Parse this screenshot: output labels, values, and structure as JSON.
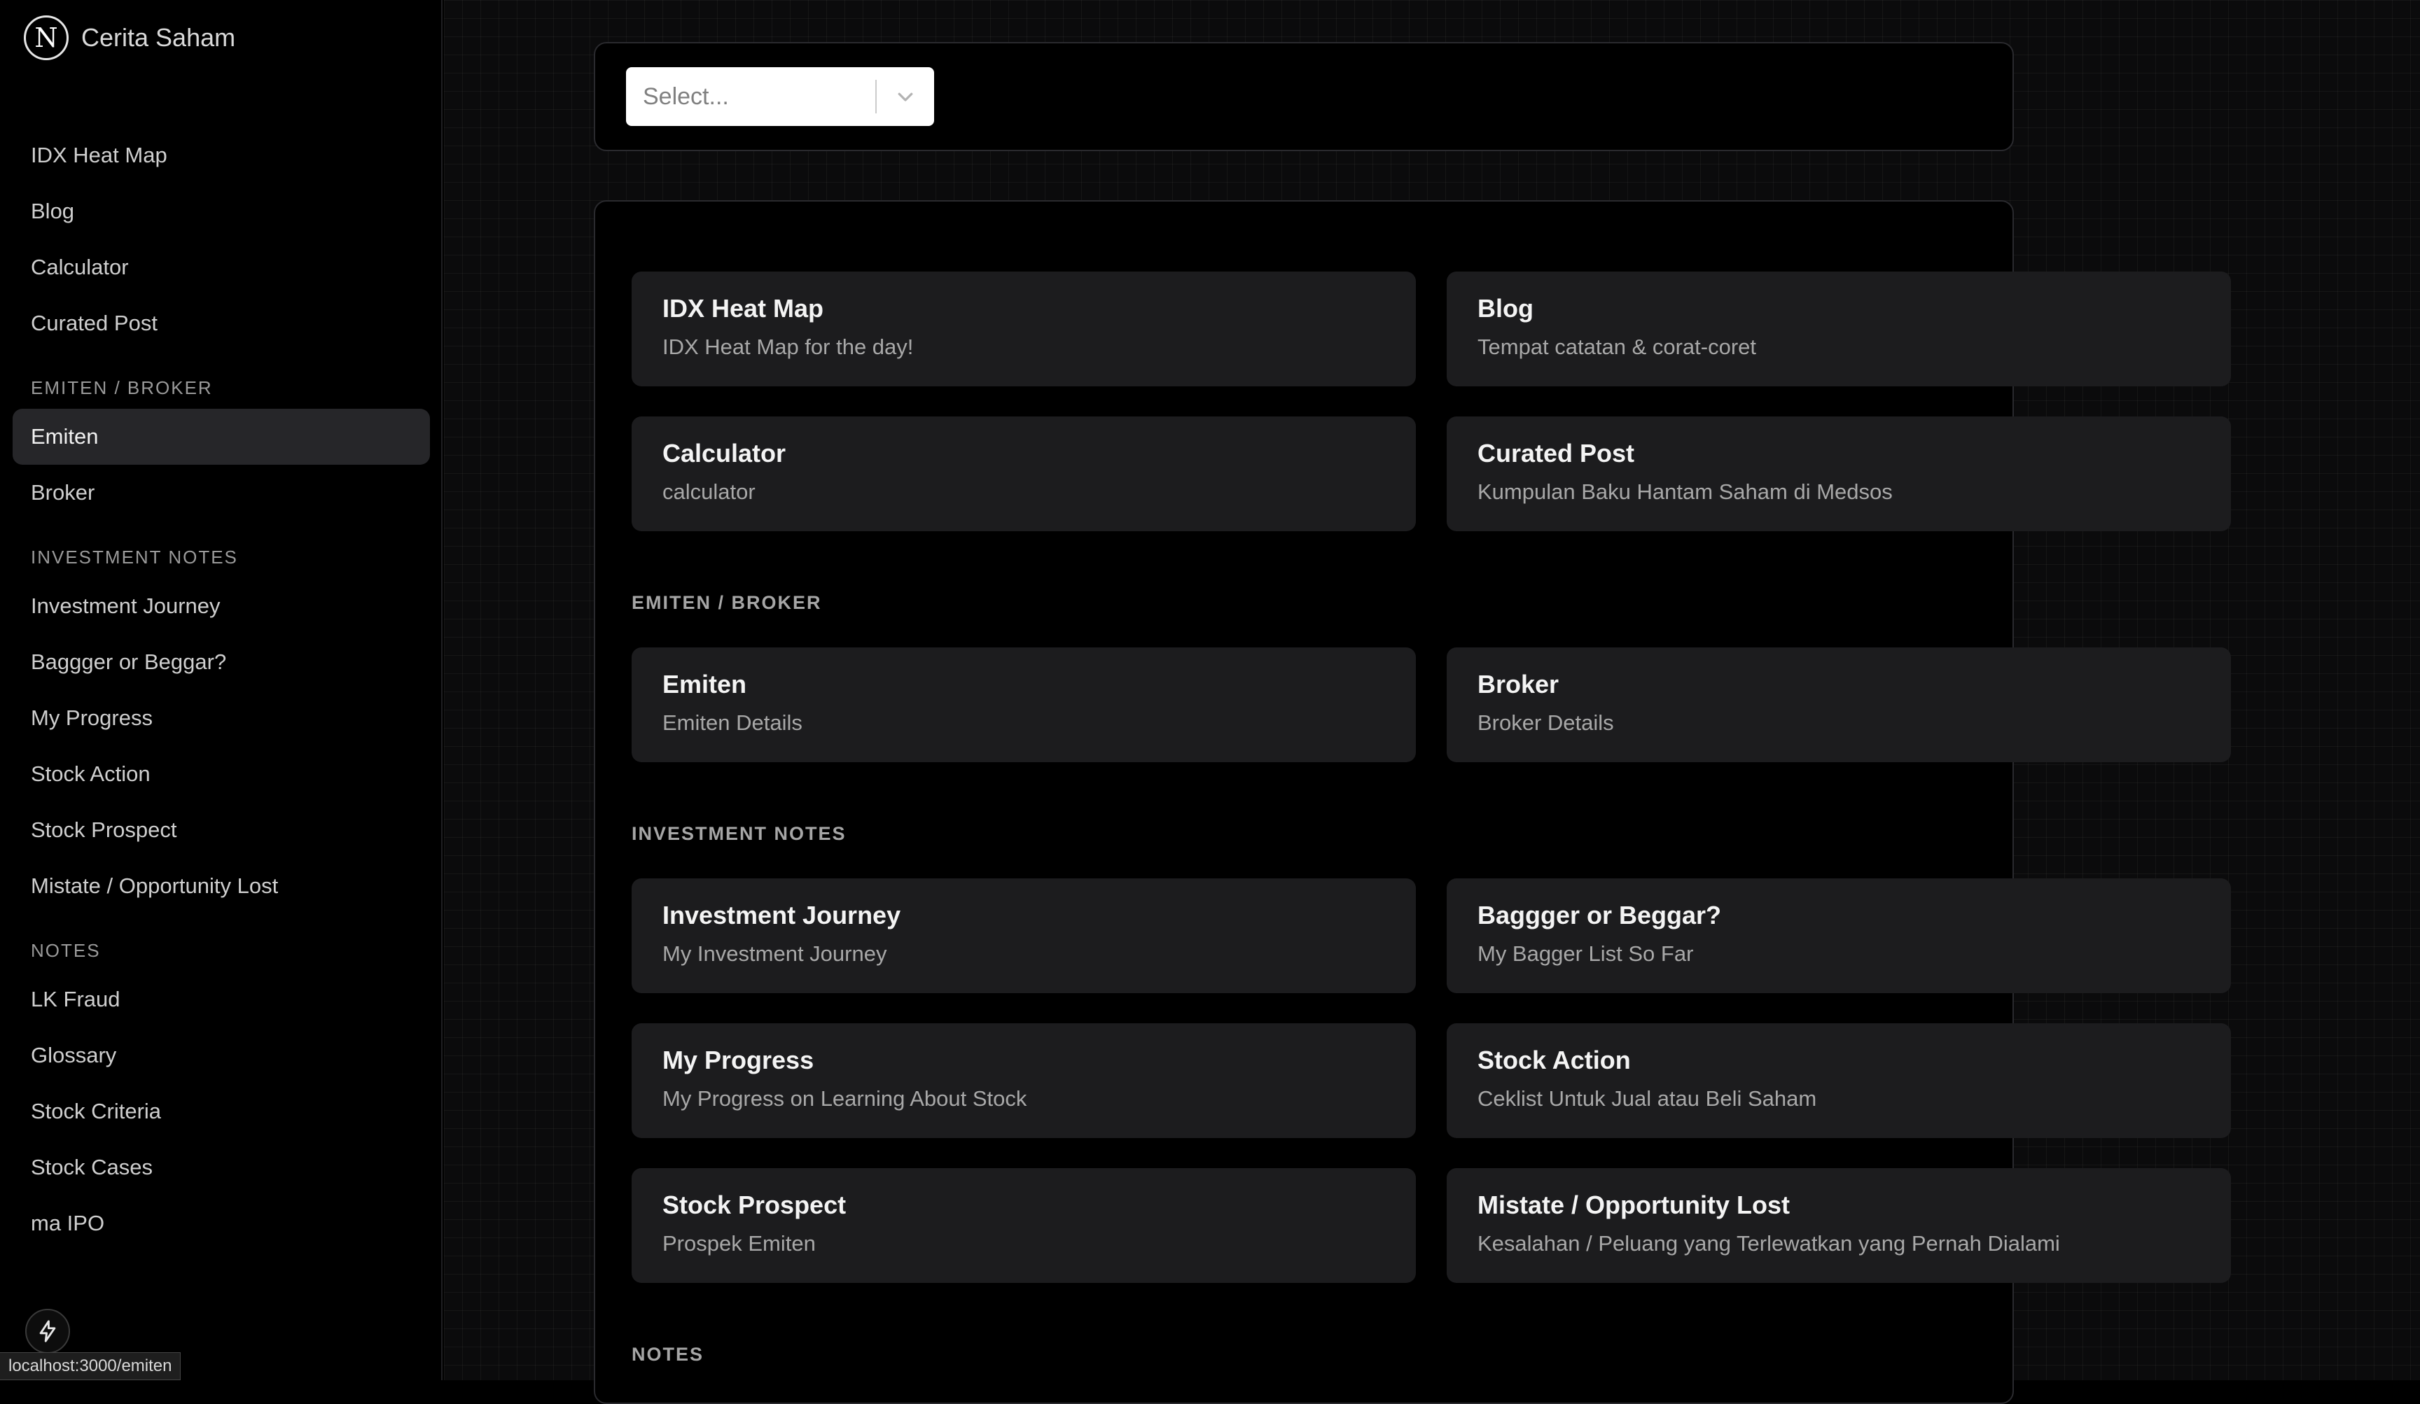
{
  "brand": {
    "logo_letter": "N",
    "name": "Cerita Saham"
  },
  "sidebar": {
    "items": [
      {
        "label": "IDX Heat Map"
      },
      {
        "label": "Blog"
      },
      {
        "label": "Calculator"
      },
      {
        "label": "Curated Post"
      }
    ],
    "sections": [
      {
        "title": "EMITEN / BROKER",
        "items": [
          {
            "label": "Emiten",
            "active": true
          },
          {
            "label": "Broker"
          }
        ]
      },
      {
        "title": "INVESTMENT NOTES",
        "items": [
          {
            "label": "Investment Journey"
          },
          {
            "label": "Baggger or Beggar?"
          },
          {
            "label": "My Progress"
          },
          {
            "label": "Stock Action"
          },
          {
            "label": "Stock Prospect"
          },
          {
            "label": "Mistate / Opportunity Lost"
          }
        ]
      },
      {
        "title": "NOTES",
        "items": [
          {
            "label": "LK Fraud"
          },
          {
            "label": "Glossary"
          },
          {
            "label": "Stock Criteria"
          },
          {
            "label": "Stock Cases"
          },
          {
            "label": "ma IPO"
          }
        ]
      }
    ]
  },
  "status_bar": {
    "url": "localhost:3000/emiten"
  },
  "search": {
    "placeholder": "Select..."
  },
  "main": {
    "top_cards": [
      {
        "title": "IDX Heat Map",
        "desc": "IDX Heat Map for the day!"
      },
      {
        "title": "Blog",
        "desc": "Tempat catatan & corat-coret"
      },
      {
        "title": "Calculator",
        "desc": "calculator"
      },
      {
        "title": "Curated Post",
        "desc": "Kumpulan Baku Hantam Saham di Medsos"
      }
    ],
    "sections": [
      {
        "title": "EMITEN / BROKER",
        "cards": [
          {
            "title": "Emiten",
            "desc": "Emiten Details"
          },
          {
            "title": "Broker",
            "desc": "Broker Details"
          }
        ]
      },
      {
        "title": "INVESTMENT NOTES",
        "cards": [
          {
            "title": "Investment Journey",
            "desc": "My Investment Journey"
          },
          {
            "title": "Baggger or Beggar?",
            "desc": "My Bagger List So Far"
          },
          {
            "title": "My Progress",
            "desc": "My Progress on Learning About Stock"
          },
          {
            "title": "Stock Action",
            "desc": "Ceklist Untuk Jual atau Beli Saham"
          },
          {
            "title": "Stock Prospect",
            "desc": "Prospek Emiten"
          },
          {
            "title": "Mistate / Opportunity Lost",
            "desc": "Kesalahan / Peluang yang Terlewatkan yang Pernah Dialami"
          }
        ]
      },
      {
        "title": "NOTES",
        "cards": []
      }
    ]
  }
}
